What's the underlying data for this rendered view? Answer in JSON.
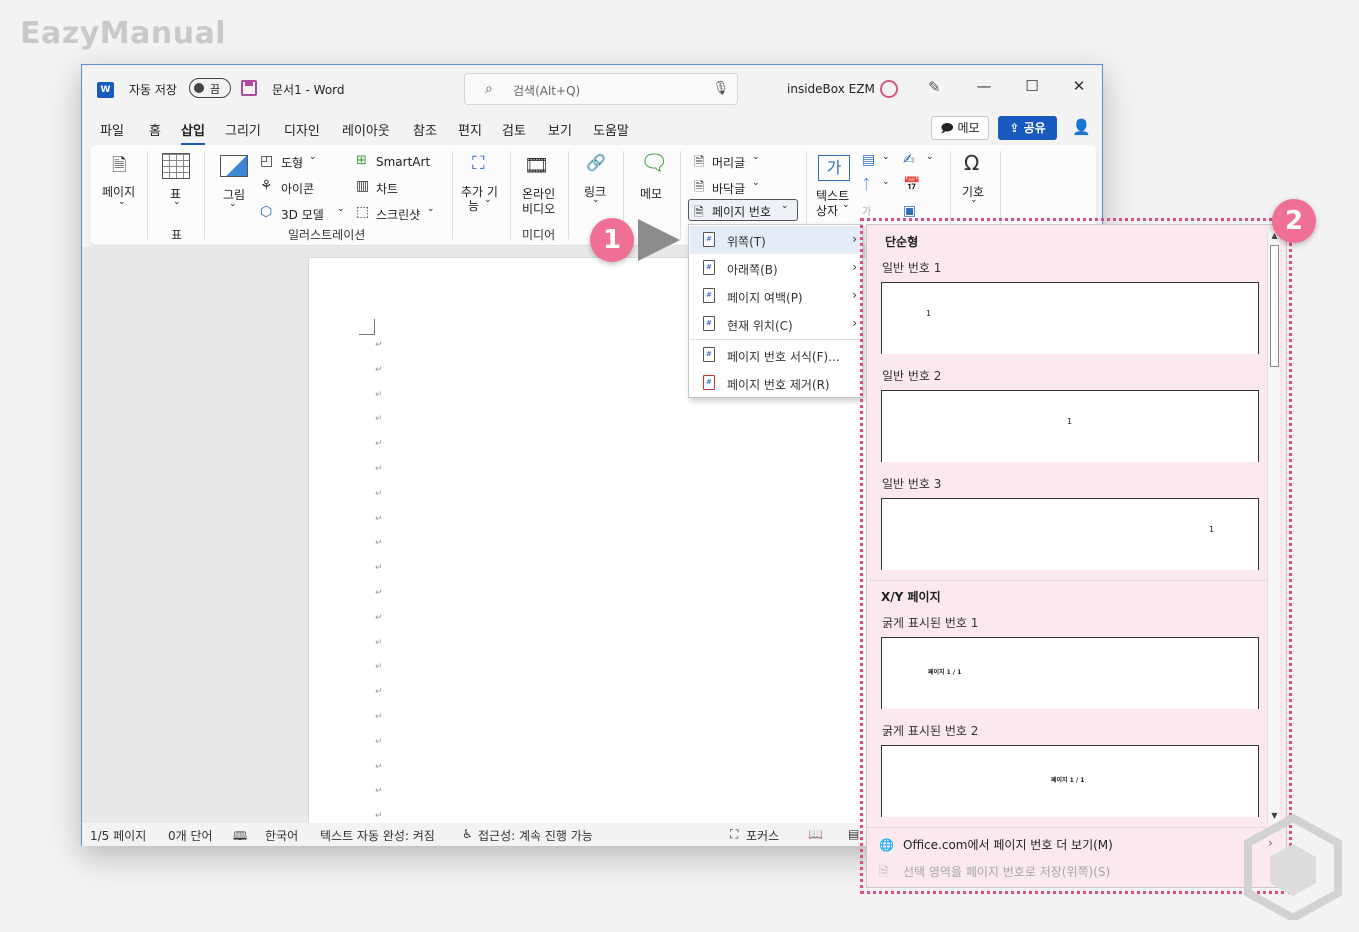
{
  "watermark": "EazyManual",
  "titlebar": {
    "autosave_label": "자동 저장",
    "toggle_state": "끔",
    "doc_title": "문서1  -  Word",
    "search_placeholder": "검색(Alt+Q)",
    "user_name": "insideBox EZM"
  },
  "tabs": [
    "파일",
    "홈",
    "삽입",
    "그리기",
    "디자인",
    "레이아웃",
    "참조",
    "편지",
    "검토",
    "보기",
    "도움말"
  ],
  "active_tab": "삽입",
  "memo_button": "메모",
  "share_button": "공유",
  "ribbon": {
    "pages": "페이지",
    "table": "표",
    "table_group": "표",
    "picture": "그림",
    "shapes": "도형",
    "icons": "아이콘",
    "model3d": "3D 모델",
    "smartart": "SmartArt",
    "chart": "차트",
    "screenshot": "스크린샷",
    "illustrations_group": "일러스트레이션",
    "addins_line1": "추가 기",
    "addins_line2": "능",
    "online_video_line1": "온라인",
    "online_video_line2": "비디오",
    "media_group": "미디어",
    "link": "링크",
    "comment": "메모",
    "header": "머리글",
    "footer": "바닥글",
    "page_number": "페이지 번호",
    "textbox_line1": "텍스트",
    "textbox_line2": "상자",
    "quick_parts_hint": "기호",
    "symbol": "기호"
  },
  "statusbar": {
    "page": "1/5 페이지",
    "words": "0개 단어",
    "language": "한국어",
    "autocomplete": "텍스트 자동 완성: 켜짐",
    "accessibility": "접근성: 계속 진행 가능",
    "focus": "포커스"
  },
  "menu": {
    "items": [
      {
        "label": "위쪽(T)",
        "submenu": true
      },
      {
        "label": "아래쪽(B)",
        "submenu": true
      },
      {
        "label": "페이지 여백(P)",
        "submenu": true
      },
      {
        "label": "현재 위치(C)",
        "submenu": true
      },
      {
        "label": "페이지 번호 서식(F)...",
        "submenu": false
      },
      {
        "label": "페이지 번호 제거(R)",
        "submenu": false
      }
    ]
  },
  "gallery": {
    "section1": "단순형",
    "items1": [
      "일반 번호 1",
      "일반 번호 2",
      "일반 번호 3"
    ],
    "section2": "X/Y 페이지",
    "items2": [
      "굵게 표시된 번호 1",
      "굵게 표시된 번호 2"
    ],
    "preview_number": "1",
    "preview_bold": "페이지 1 / 1",
    "footer_more": "Office.com에서 페이지 번호 더 보기(M)",
    "footer_save": "선택 영역을 페이지 번호로 저장(위쪽)(S)"
  },
  "badges": [
    "1",
    "2"
  ]
}
